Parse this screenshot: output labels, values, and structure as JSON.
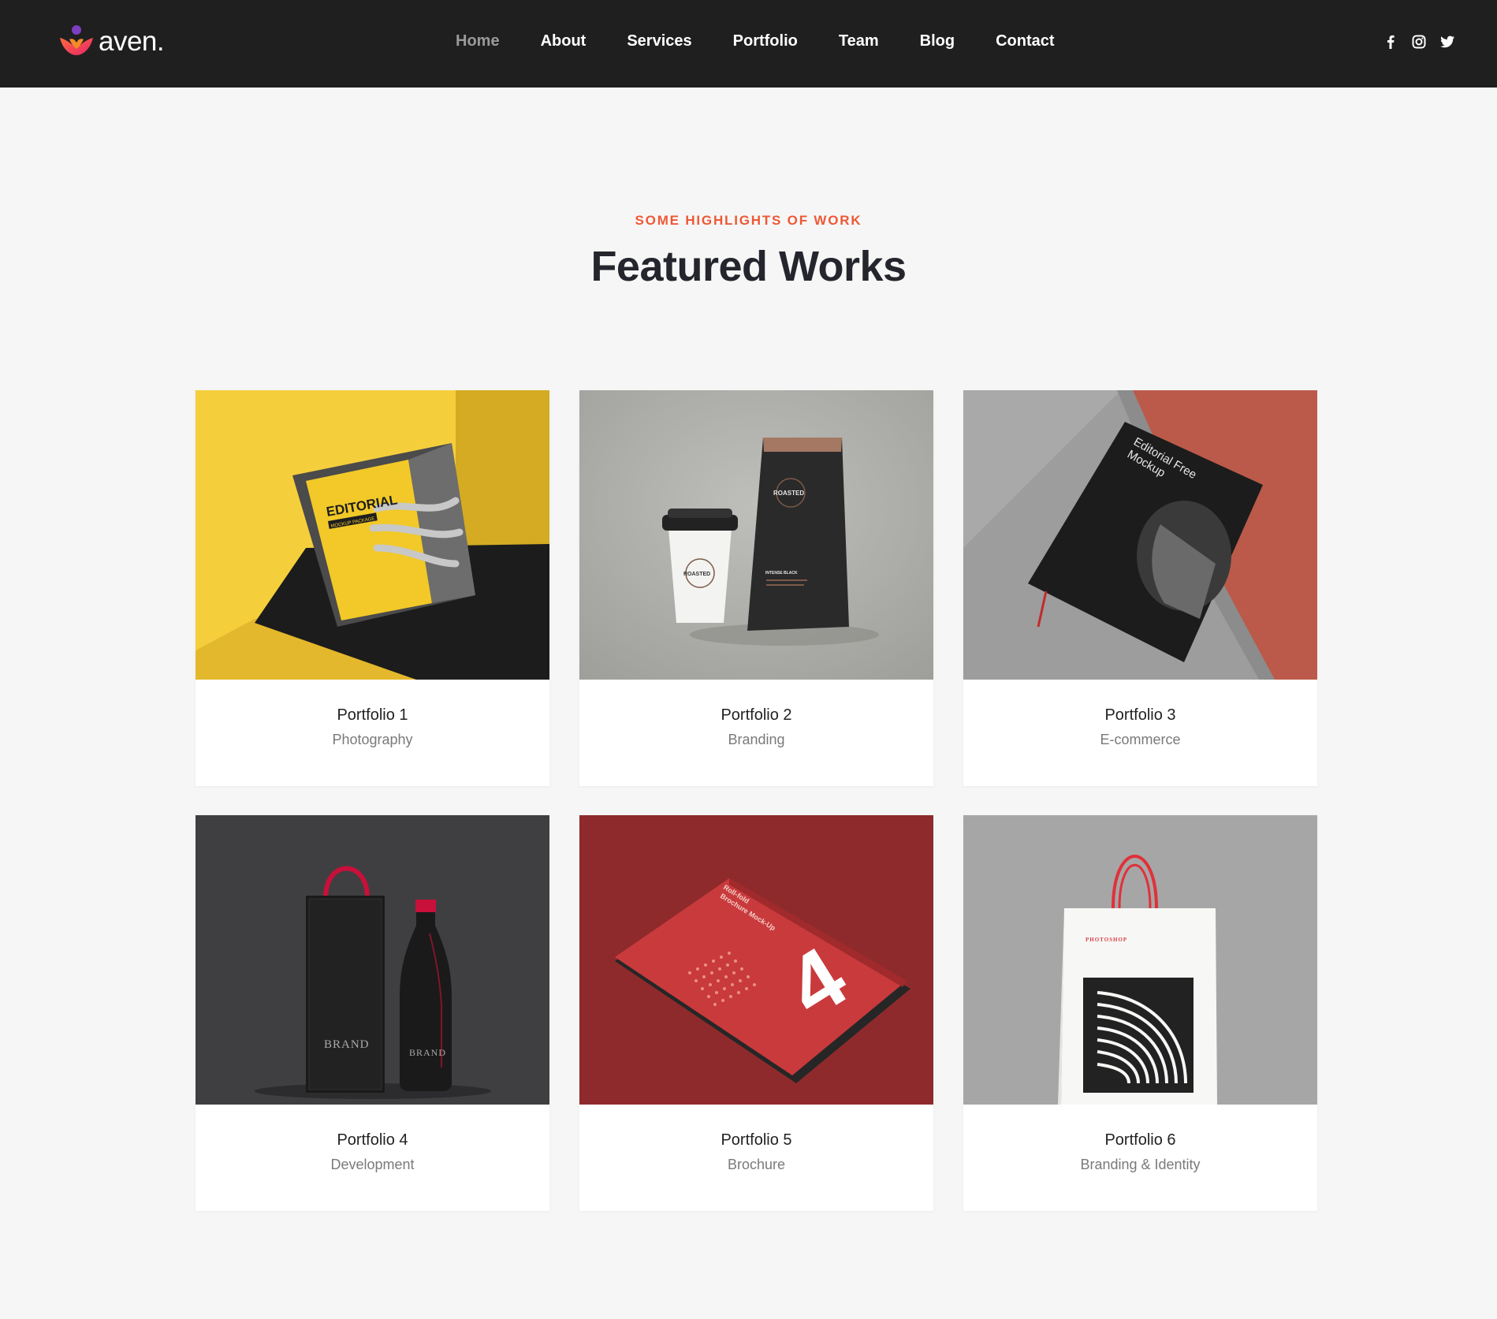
{
  "brand": {
    "name": "aven."
  },
  "nav": {
    "items": [
      {
        "label": "Home",
        "active": true
      },
      {
        "label": "About",
        "active": false
      },
      {
        "label": "Services",
        "active": false
      },
      {
        "label": "Portfolio",
        "active": false
      },
      {
        "label": "Team",
        "active": false
      },
      {
        "label": "Blog",
        "active": false
      },
      {
        "label": "Contact",
        "active": false
      }
    ],
    "social": [
      "facebook-icon",
      "instagram-icon",
      "twitter-icon"
    ]
  },
  "section": {
    "eyebrow": "SOME HIGHLIGHTS OF WORK",
    "title": "Featured Works"
  },
  "portfolio": [
    {
      "title": "Portfolio 1",
      "category": "Photography"
    },
    {
      "title": "Portfolio 2",
      "category": "Branding"
    },
    {
      "title": "Portfolio 3",
      "category": "E-commerce"
    },
    {
      "title": "Portfolio 4",
      "category": "Development"
    },
    {
      "title": "Portfolio 5",
      "category": "Brochure"
    },
    {
      "title": "Portfolio 6",
      "category": "Branding & Identity"
    }
  ],
  "mockup_text": {
    "p1": {
      "headline": "EDITORIAL",
      "sub": "MOCKUP PACKAGE"
    },
    "p2": {
      "cup": "ROASTED",
      "bag": "ROASTED",
      "bag_sub": "INTENSE BLACK"
    },
    "p3": {
      "line1": "Editorial Free",
      "line2": "Mockup"
    },
    "p4": {
      "box": "BRAND",
      "bottle": "BRAND"
    },
    "p5": {
      "line1": "Roll-fold",
      "line2": "Brochure Mock-Up",
      "number": "4"
    },
    "p6": {
      "label": "PHOTOSHOP"
    }
  },
  "colors": {
    "navbar": "#1f1f1f",
    "accent": "#ee5836",
    "title": "#24252d",
    "background": "#f6f6f6"
  }
}
